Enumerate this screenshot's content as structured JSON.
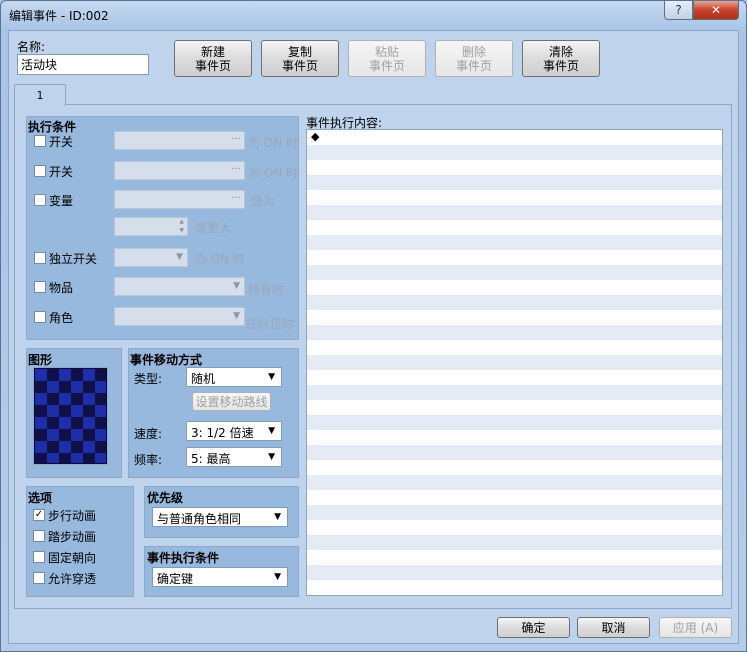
{
  "window": {
    "title": "编辑事件 - ID:002",
    "help": "?",
    "close": "✕"
  },
  "name": {
    "label": "名称:",
    "value": "活动块"
  },
  "toolbar": {
    "new": {
      "line1": "新建",
      "line2": "事件页"
    },
    "copy": {
      "line1": "复制",
      "line2": "事件页"
    },
    "paste": {
      "line1": "粘贴",
      "line2": "事件页"
    },
    "delete": {
      "line1": "删除",
      "line2": "事件页"
    },
    "clear": {
      "line1": "清除",
      "line2": "事件页"
    }
  },
  "tabs": [
    {
      "label": "1"
    }
  ],
  "conditions": {
    "title": "执行条件",
    "switch1": {
      "label": "开关",
      "suffix": "为 ON 时",
      "dots": "···"
    },
    "switch2": {
      "label": "开关",
      "suffix": "为 ON 时",
      "dots": "···"
    },
    "variable": {
      "label": "变量",
      "suffix": "值为",
      "dots": "···",
      "more": "或更大"
    },
    "self_switch": {
      "label": "独立开关",
      "suffix": "为 ON 时"
    },
    "item": {
      "label": "物品",
      "suffix": "持有时"
    },
    "actor": {
      "label": "角色",
      "suffix": "在队伍时"
    }
  },
  "graphic": {
    "title": "图形"
  },
  "movement": {
    "title": "事件移动方式",
    "type_label": "类型:",
    "type_value": "随机",
    "route_button": "设置移动路线",
    "speed_label": "速度:",
    "speed_value": "3: 1/2 倍速",
    "freq_label": "频率:",
    "freq_value": "5: 最高"
  },
  "options": {
    "title": "选项",
    "items": [
      {
        "label": "步行动画",
        "checked": "✓"
      },
      {
        "label": "踏步动画",
        "checked": ""
      },
      {
        "label": "固定朝向",
        "checked": ""
      },
      {
        "label": "允许穿透",
        "checked": ""
      }
    ]
  },
  "priority": {
    "title": "优先级",
    "value": "与普通角色相同"
  },
  "trigger": {
    "title": "事件执行条件",
    "value": "确定键"
  },
  "contents": {
    "title": "事件执行内容:",
    "first_line": "◆"
  },
  "footer": {
    "ok": "确定",
    "cancel": "取消",
    "apply": "应用 (A)"
  },
  "colors": {
    "tile_dark": "#101048",
    "tile_light": "#1e2ea8",
    "graphic_bg": "#0b0b3a"
  },
  "icons": {
    "dropdown": "chevron-down-icon",
    "spin_up": "▲",
    "spin_down": "▼",
    "arrow": "▼"
  }
}
